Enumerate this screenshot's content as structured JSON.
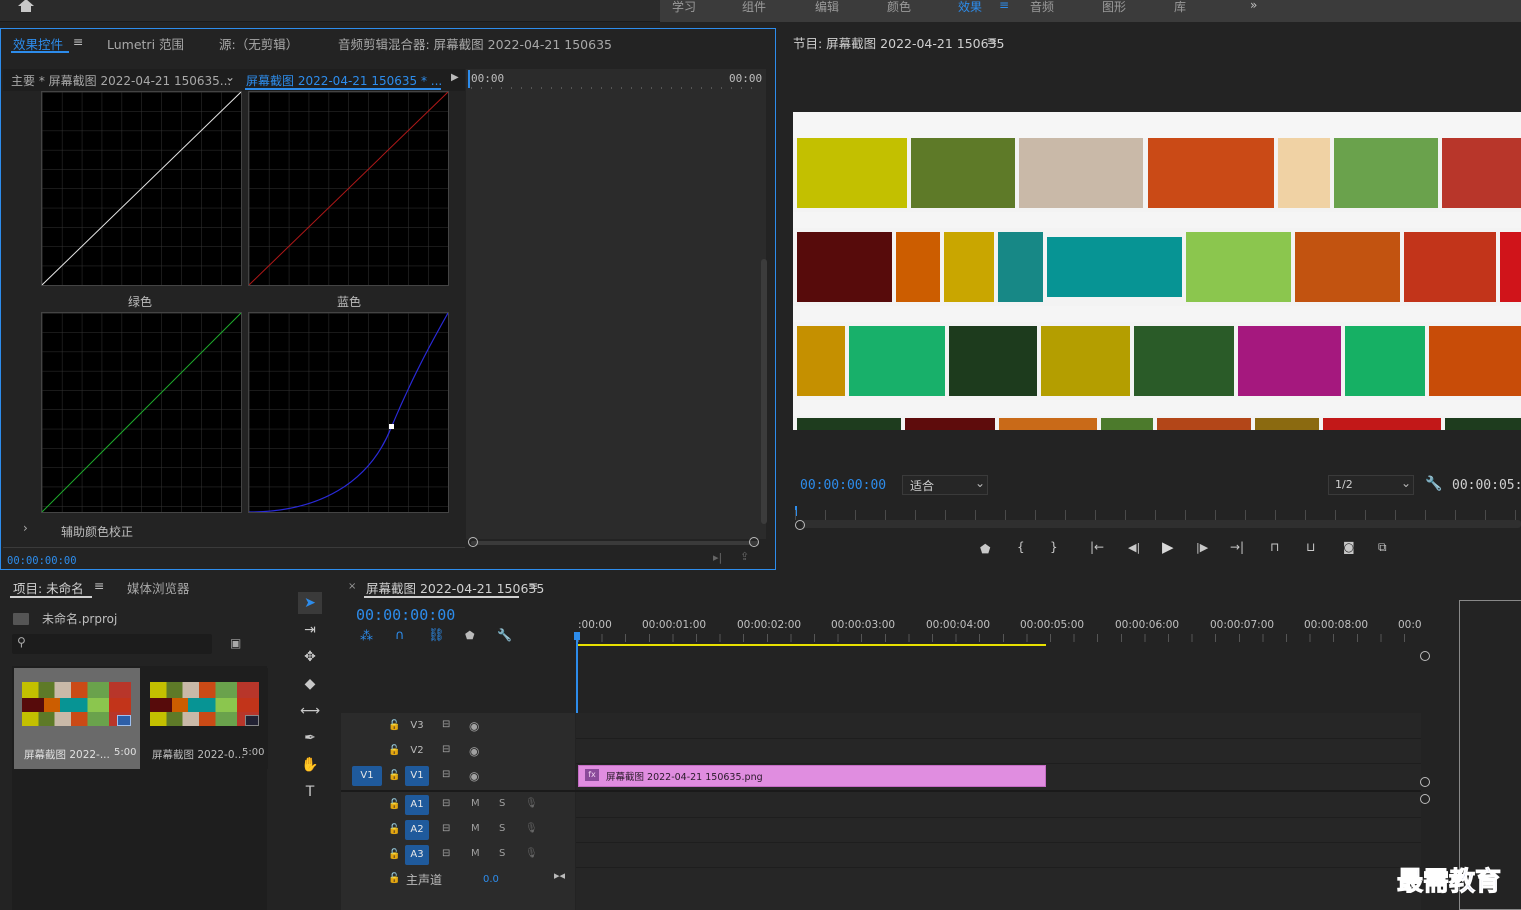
{
  "workspaces": {
    "items": [
      "学习",
      "组件",
      "编辑",
      "颜色",
      "效果",
      "音频",
      "图形",
      "库"
    ],
    "active": "效果",
    "more": "»"
  },
  "effect_controls": {
    "tabs": [
      "效果控件",
      "Lumetri 范围",
      "源:（无剪辑）",
      "音频剪辑混合器: 屏幕截图 2022-04-21 150635"
    ],
    "master_label": "主要 * 屏幕截图 2022-04-21 150635...",
    "clip_label": "屏幕截图 2022-04-21 150635 * ...",
    "time_start": "00:00",
    "time_end": "00:00",
    "green_label": "绿色",
    "blue_label": "蓝色",
    "section": "辅助颜色校正",
    "timecode": "00:00:00:00"
  },
  "program": {
    "title": "节目: 屏幕截图 2022-04-21 150635",
    "timecode": "00:00:00:00",
    "fit": "适合",
    "resolution": "1/2",
    "duration": "00:00:05:0"
  },
  "project": {
    "tabs": [
      "项目: 未命名",
      "媒体浏览器"
    ],
    "file": "未命名.prproj",
    "items": [
      {
        "name": "屏幕截图 2022-...",
        "duration": "5:00"
      },
      {
        "name": "屏幕截图 2022-0...",
        "duration": "5:00"
      }
    ]
  },
  "timeline": {
    "title": "屏幕截图 2022-04-21 150635",
    "timecode": "00:00:00:00",
    "ruler": [
      ":00:00",
      "00:00:01:00",
      "00:00:02:00",
      "00:00:03:00",
      "00:00:04:00",
      "00:00:05:00",
      "00:00:06:00",
      "00:00:07:00",
      "00:00:08:00",
      "00:0"
    ],
    "video_tracks": [
      "V3",
      "V2",
      "V1"
    ],
    "source_patch": "V1",
    "audio_tracks": [
      "A1",
      "A2",
      "A3"
    ],
    "master": "主声道",
    "master_value": "0.0",
    "clip": "屏幕截图 2022-04-21 150635.png",
    "clip_fx": "fx",
    "mute": "M",
    "solo": "S"
  },
  "watermark": "最需教育",
  "colors": {
    "accent": "#2d8ceb",
    "clip": "#e08de0",
    "work_area": "#e8e000"
  }
}
